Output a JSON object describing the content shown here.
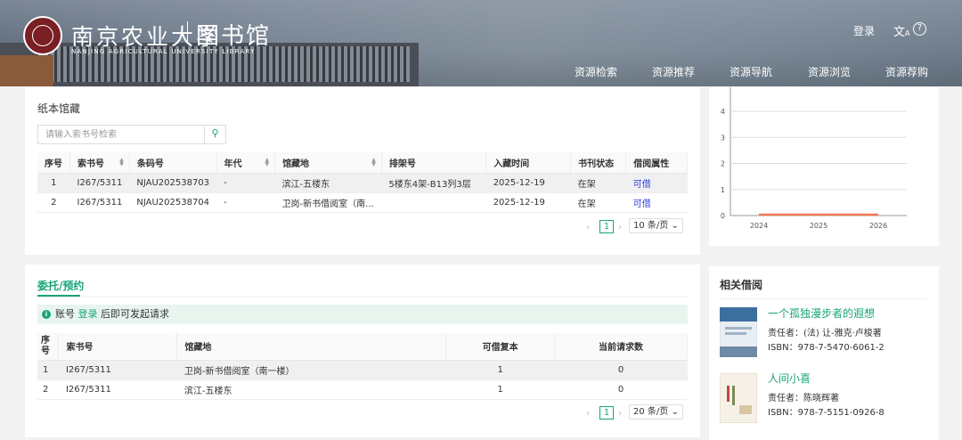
{
  "header": {
    "university_name": "南京农业大学",
    "library_name": "图书馆",
    "english_name": "NANJING AGRICULTURAL UNIVERSITY LIBRARY",
    "login_label": "登录",
    "nav": [
      "资源检索",
      "资源推荐",
      "资源导航",
      "资源浏览",
      "资源荐购"
    ]
  },
  "holdings": {
    "title": "纸本馆藏",
    "search_placeholder": "请输入索书号检索",
    "columns": [
      "序号",
      "索书号",
      "条码号",
      "年代",
      "馆藏地",
      "排架号",
      "入藏时间",
      "书刊状态",
      "借阅属性"
    ],
    "rows": [
      {
        "no": "1",
        "call": "I267/5311",
        "barcode": "NJAU202538703",
        "year": "-",
        "location": "滨江-五楼东",
        "shelf": "5楼东4架-B13列3层",
        "date": "2025-12-19",
        "status": "在架",
        "loan": "可借"
      },
      {
        "no": "2",
        "call": "I267/5311",
        "barcode": "NJAU202538704",
        "year": "-",
        "location": "卫岗-新书借阅室（南...",
        "shelf": "",
        "date": "2025-12-19",
        "status": "在架",
        "loan": "可借"
      }
    ],
    "page": "1",
    "page_size": "10 条/页"
  },
  "reserve": {
    "tab": "委托/预约",
    "notice_pre": "账号",
    "notice_link": "登录",
    "notice_post": "后即可发起请求",
    "columns": [
      "序号",
      "索书号",
      "馆藏地",
      "可借复本",
      "当前请求数"
    ],
    "rows": [
      {
        "no": "1",
        "call": "I267/5311",
        "location": "卫岗-新书借阅室（南一楼）",
        "copies": "1",
        "requests": "0"
      },
      {
        "no": "2",
        "call": "I267/5311",
        "location": "滨江-五楼东",
        "copies": "1",
        "requests": "0"
      }
    ],
    "page": "1",
    "page_size": "20 条/页"
  },
  "chart_data": {
    "type": "line",
    "x": [
      2024,
      2025,
      2026
    ],
    "y_ticks": [
      0,
      1,
      2,
      3,
      4
    ],
    "ylim": [
      0,
      4
    ],
    "series": [
      {
        "values": [
          0,
          0,
          0
        ],
        "color": "#f07850"
      }
    ],
    "grid": true
  },
  "related": {
    "title": "相关借阅",
    "books": [
      {
        "title": "一个孤独漫步者的遐想",
        "author": "责任者：(法) 让-雅克·卢梭著",
        "isbn": "ISBN：978-7-5470-6061-2"
      },
      {
        "title": "人间小喜",
        "author": "责任者：陈晓辉著",
        "isbn": "ISBN：978-7-5151-0926-8"
      }
    ]
  },
  "colors": {
    "accent": "#1aa47a",
    "link": "#2b3ed6"
  }
}
